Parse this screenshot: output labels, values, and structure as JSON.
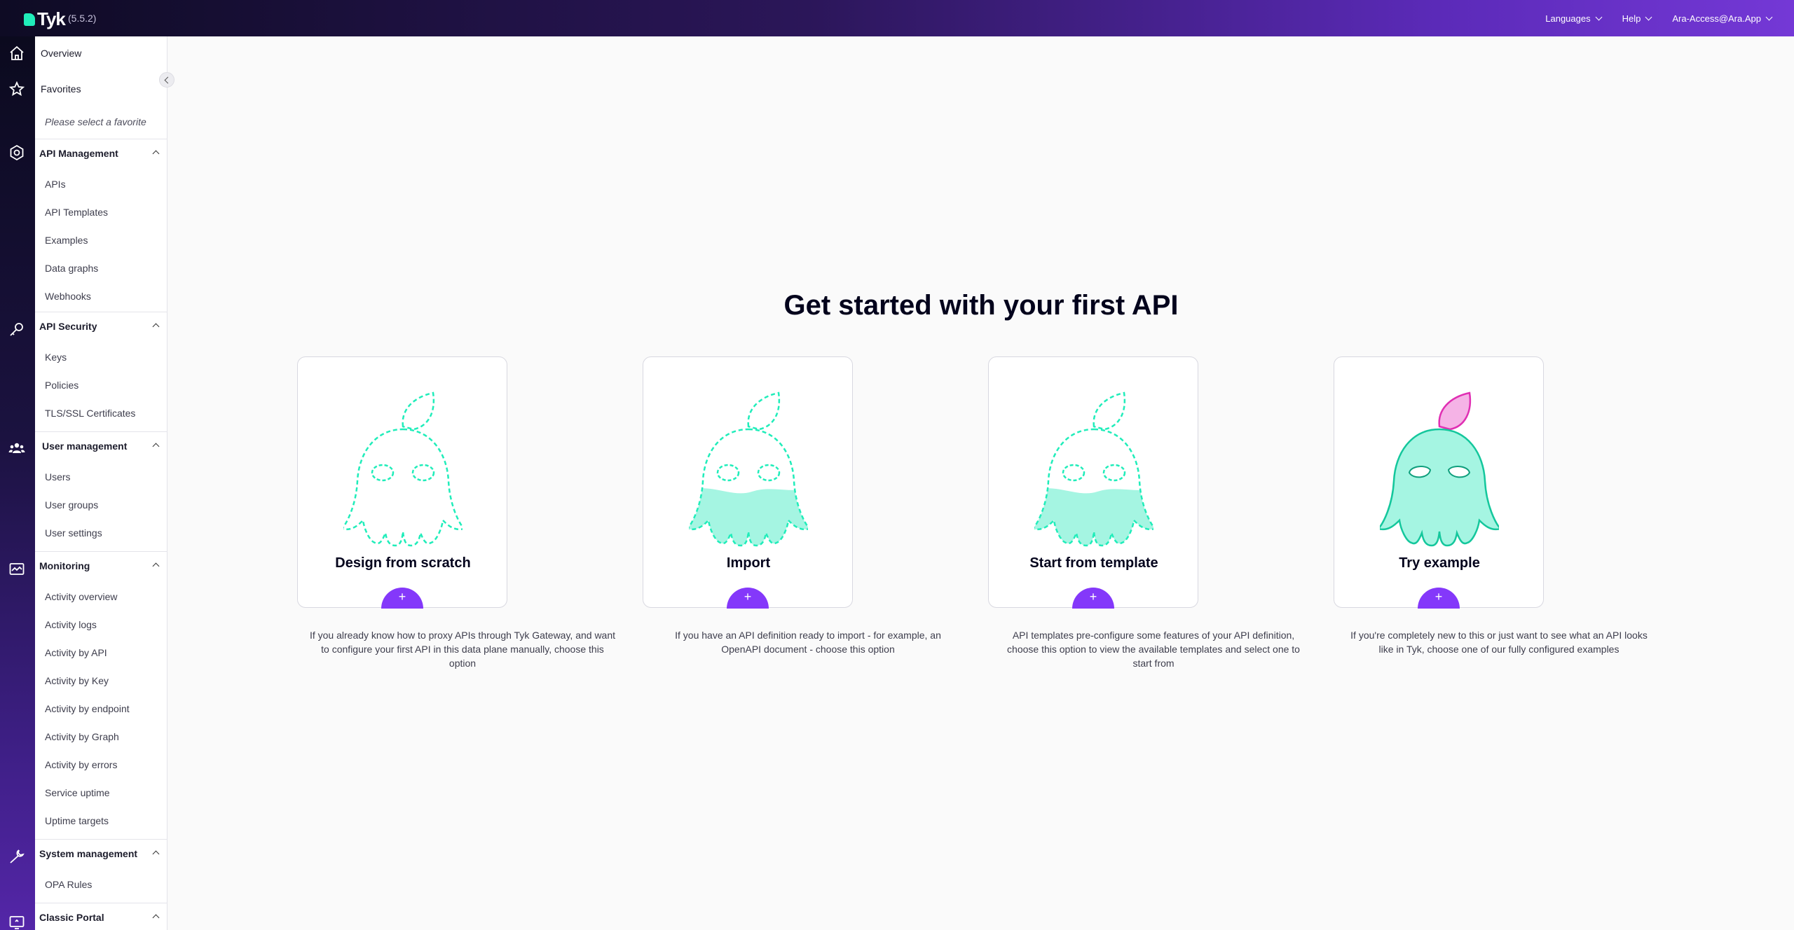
{
  "app": {
    "logo_text": "Tyk",
    "version": "(5.5.2)"
  },
  "topbar": {
    "languages": "Languages",
    "help": "Help",
    "user": "Ara-Access@Ara.App"
  },
  "colors": {
    "accent": "#8438fa",
    "mint": "#20edba",
    "pink": "#f58ad8"
  },
  "rail_icons": [
    "home-icon",
    "star-icon",
    "gear-icon",
    "key-icon",
    "users-icon",
    "monitor-icon",
    "wrench-icon",
    "portal-icon"
  ],
  "sidebar": {
    "overview": "Overview",
    "favorites": "Favorites",
    "favorites_empty": "Please select a favorite",
    "sections": [
      {
        "label": "API Management",
        "items": [
          "APIs",
          "API Templates",
          "Examples",
          "Data graphs",
          "Webhooks"
        ]
      },
      {
        "label": "API Security",
        "items": [
          "Keys",
          "Policies",
          "TLS/SSL Certificates"
        ]
      },
      {
        "label": "User management",
        "items": [
          "Users",
          "User groups",
          "User settings"
        ]
      },
      {
        "label": "Monitoring",
        "items": [
          "Activity overview",
          "Activity logs",
          "Activity by API",
          "Activity by Key",
          "Activity by endpoint",
          "Activity by Graph",
          "Activity by errors",
          "Service uptime",
          "Uptime targets"
        ]
      },
      {
        "label": "System management",
        "items": [
          "OPA Rules"
        ]
      },
      {
        "label": "Classic Portal",
        "items": []
      }
    ]
  },
  "main": {
    "heading": "Get started with your first API",
    "cards": [
      {
        "title": "Design from scratch",
        "button": "+",
        "description": "If you already know how to proxy APIs through Tyk Gateway, and want to configure your first API in this data plane manually, choose this option"
      },
      {
        "title": "Import",
        "button": "+",
        "description": "If you have an API definition ready to import - for example, an OpenAPI document - choose this option"
      },
      {
        "title": "Start from template",
        "button": "+",
        "description": "API templates pre-configure some features of your API definition, choose this option to view the available templates and select one to start from"
      },
      {
        "title": "Try example",
        "button": "+",
        "description": "If you're completely new to this or just want to see what an API looks like in Tyk, choose one of our fully configured examples"
      }
    ]
  }
}
